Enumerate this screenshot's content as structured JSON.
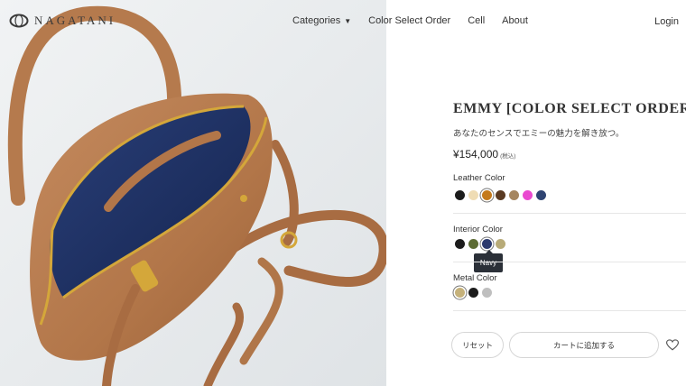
{
  "header": {
    "logo_text": "NAGATANI",
    "nav": [
      {
        "label": "Categories",
        "has_dropdown": true
      },
      {
        "label": "Color Select Order"
      },
      {
        "label": "Cell"
      },
      {
        "label": "About"
      }
    ],
    "login_label": "Login"
  },
  "product": {
    "title": "EMMY [COLOR SELECT ORDER]",
    "tagline": "あなたのセンスでエミーの魅力を解き放つ。",
    "price": "¥154,000",
    "price_tax_note": "(税込)",
    "image_alt": "tan leather handbag with navy lining"
  },
  "options": {
    "leather": {
      "label": "Leather Color",
      "swatches": [
        "#1c1c1c",
        "#efdcb4",
        "#c47a1c",
        "#5a3a22",
        "#a5865f",
        "#ea4ad0",
        "#2f4472"
      ],
      "selected_index": 2
    },
    "interior": {
      "label": "Interior Color",
      "swatches": [
        "#1c1c1c",
        "#5c6b33",
        "#2c3a6e",
        "#b8ab78"
      ],
      "selected_index": 2,
      "tooltip": "Navy"
    },
    "metal": {
      "label": "Metal Color",
      "swatches": [
        "#c5b17a",
        "#1c1c1c",
        "#bfbfbf"
      ],
      "selected_index": 0
    }
  },
  "actions": {
    "reset_label": "リセット",
    "cart_label": "カートに追加する"
  },
  "colors": {
    "bag_leather": "#b87d52",
    "lining": "#1f3366",
    "hardware": "#d4a73a",
    "image_background": "#e9ecee"
  }
}
